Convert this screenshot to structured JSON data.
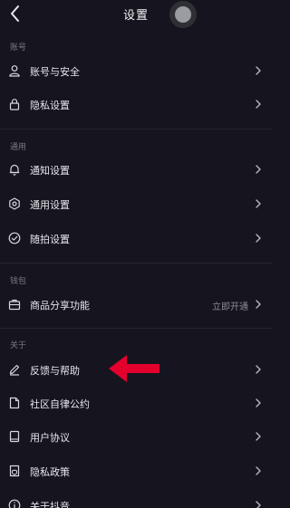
{
  "nav": {
    "title": "设置"
  },
  "sections": {
    "account": {
      "label": "账号",
      "items": [
        {
          "label": "账号与安全",
          "icon": "user-icon"
        },
        {
          "label": "隐私设置",
          "icon": "lock-icon"
        }
      ]
    },
    "general": {
      "label": "通用",
      "items": [
        {
          "label": "通知设置",
          "icon": "bell-icon"
        },
        {
          "label": "通用设置",
          "icon": "gear-icon"
        },
        {
          "label": "随拍设置",
          "icon": "check-circle-icon"
        }
      ]
    },
    "wallet": {
      "label": "钱包",
      "items": [
        {
          "label": "商品分享功能",
          "value": "立即开通",
          "icon": "briefcase-icon"
        }
      ]
    },
    "about": {
      "label": "关于",
      "items": [
        {
          "label": "反馈与帮助",
          "icon": "pencil-icon"
        },
        {
          "label": "社区自律公约",
          "icon": "document-icon"
        },
        {
          "label": "用户协议",
          "icon": "book-icon"
        },
        {
          "label": "隐私政策",
          "icon": "shield-doc-icon"
        },
        {
          "label": "关于抖音",
          "icon": "info-icon"
        }
      ]
    }
  },
  "colors": {
    "background": "#16151f",
    "text_primary": "#e6e6ec",
    "text_secondary": "#7a7985",
    "annotation_arrow": "#e3002d"
  }
}
